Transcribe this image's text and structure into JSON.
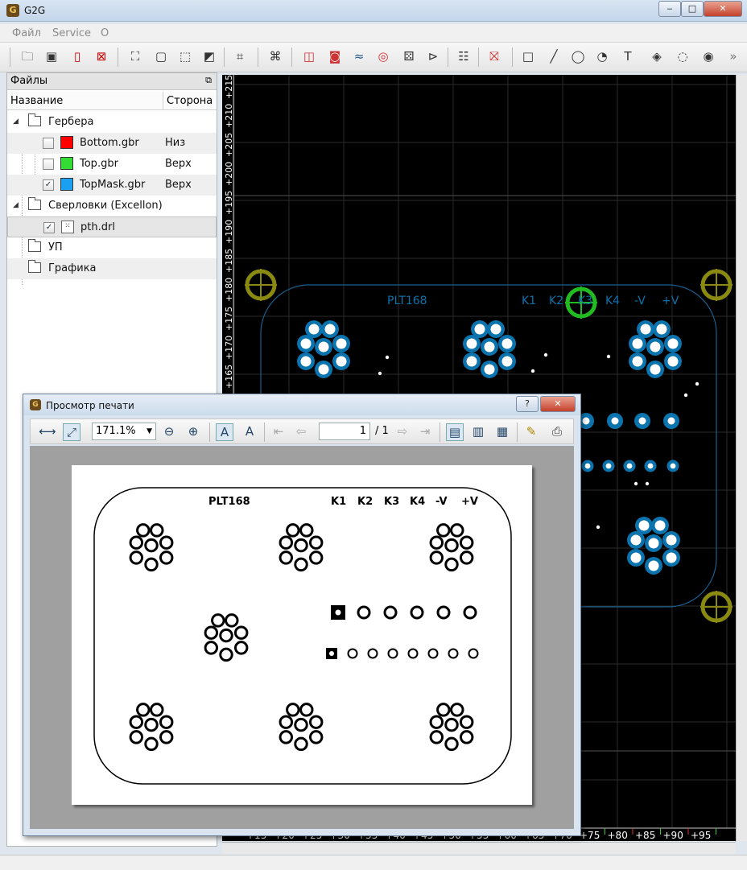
{
  "window": {
    "title": "G2G",
    "min": "‒",
    "max": "□",
    "close": "✕"
  },
  "menu": [
    "Файл",
    "Service",
    "O"
  ],
  "panel": {
    "title": "Файлы",
    "float_icon": "⧉",
    "col_name": "Название",
    "col_side": "Сторона",
    "groups": {
      "gerber": "Гербера",
      "drill": "Сверловки (Excellon)",
      "up": "УП",
      "graphics": "Графика"
    },
    "files": [
      {
        "name": "Bottom.gbr",
        "side": "Низ",
        "color": "#ff0000",
        "checked": ""
      },
      {
        "name": "Top.gbr",
        "side": "Верх",
        "color": "#33dd33",
        "checked": ""
      },
      {
        "name": "TopMask.gbr",
        "side": "Верх",
        "color": "#1aa0f0",
        "checked": "✓"
      }
    ],
    "drill_file": {
      "name": "pth.drl",
      "checked": "✓"
    }
  },
  "canvas": {
    "board_label": "PLT168",
    "labels": [
      "K1",
      "K2",
      "K3",
      "K4",
      "-V",
      "+V"
    ],
    "y_ruler": [
      "+165",
      "+170",
      "+175",
      "+180",
      "+185",
      "+190",
      "+195",
      "+200",
      "+205",
      "+210",
      "+215"
    ],
    "x_ruler": [
      "+15",
      "+20",
      "+25",
      "+30",
      "+35",
      "+40",
      "+45",
      "+50",
      "+55",
      "+60",
      "+65",
      "+70",
      "+75",
      "+80",
      "+85",
      "+90",
      "+95"
    ],
    "colors": {
      "pad": "#0b73ad",
      "outline": "#1a5f90",
      "marker": "#8a8a10",
      "marker_active": "#22bb22"
    }
  },
  "preview": {
    "title": "Просмотр печати",
    "help": "?",
    "close": "✕",
    "zoom": "171.1%",
    "page": "1",
    "page_total": "/ 1",
    "paper_label": "PLT168",
    "paper_labels": [
      "K1",
      "K2",
      "K3",
      "K4",
      "-V",
      "+V"
    ]
  }
}
